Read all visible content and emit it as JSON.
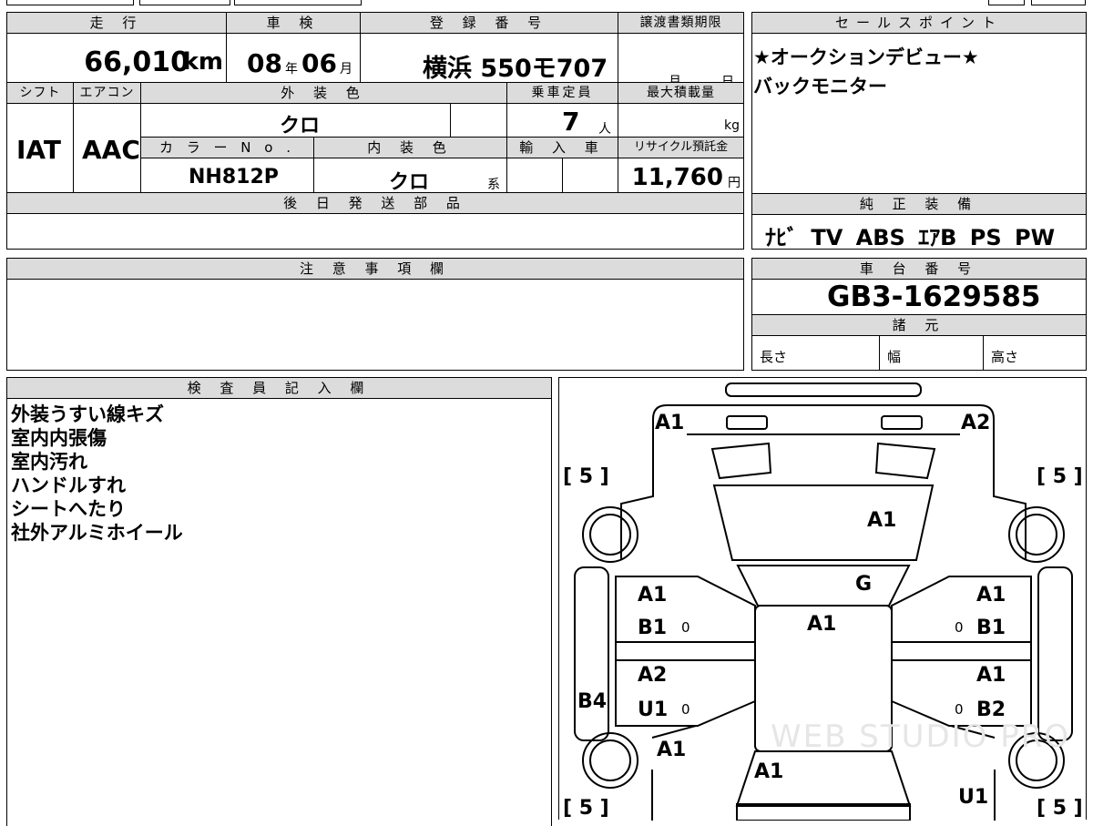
{
  "top": {
    "mileage_h": "走 行",
    "mileage": "66,010",
    "mileage_unit": "km",
    "shaken_h": "車 検",
    "shaken_year": "08",
    "shaken_year_unit": "年",
    "shaken_month": "06",
    "shaken_month_unit": "月",
    "reg_h": "登 録 番 号",
    "reg": "横浜 550モ707",
    "transfer_h": "譲渡書類期限",
    "transfer_month": "月",
    "transfer_day": "日",
    "shift_h": "シフト",
    "shift": "IAT",
    "ac_h": "エアコン",
    "ac": "AAC",
    "exterior_h": "外 装 色",
    "exterior": "クロ",
    "capacity_h": "乗車定員",
    "capacity": "7",
    "capacity_unit": "人",
    "loadmax_h": "最大積載量",
    "loadmax_unit": "kg",
    "color_no_h": "カ ラ ー N o .",
    "color_no": "NH812P",
    "interior_h": "内 装 色",
    "interior": "クロ",
    "interior_unit": "系",
    "import_h": "輸 入 車",
    "recycle_h": "リサイクル預託金",
    "recycle": "11,760",
    "recycle_unit": "円",
    "later_h": "後 日 発 送 部 品"
  },
  "sales": {
    "header": "セールスポイント",
    "lines": [
      "★オークションデビュー★",
      "バックモニター"
    ]
  },
  "equipment": {
    "header": "純 正 装 備",
    "items": "ﾅﾋﾞ TV ABS ｴｱB PS PW"
  },
  "notes": {
    "header": "注 意 事 項 欄"
  },
  "chassis": {
    "header": "車 台 番 号",
    "value": "GB3-1629585"
  },
  "specs": {
    "header": "諸 元",
    "length": "長さ",
    "width": "幅",
    "height": "高さ"
  },
  "inspector": {
    "header": "検 査 員 記 入 欄",
    "lines": [
      "外装うすい線キズ",
      "室内内張傷",
      "室内汚れ",
      "ハンドルすれ",
      "シートへたり",
      "社外アルミホイール"
    ]
  },
  "diagram": {
    "bracket": "[ 5 ]",
    "marks": {
      "front_left": "A1",
      "front_right": "A2",
      "bonnet": "A1",
      "windshield": "G",
      "roof": "A1",
      "fl_door_a": "A1",
      "fl_door_b": "B1",
      "rl_door_a": "A2",
      "rl_door_u": "U1",
      "fr_door_a": "A1",
      "fr_door_b": "B1",
      "rr_door_a": "A1",
      "rr_door_b": "B2",
      "left_step": "B4",
      "rear_left": "A1",
      "tailgate": "A1",
      "rear_right": "U1",
      "zero": "0"
    },
    "watermark": "WEB STUDIO PRO"
  }
}
